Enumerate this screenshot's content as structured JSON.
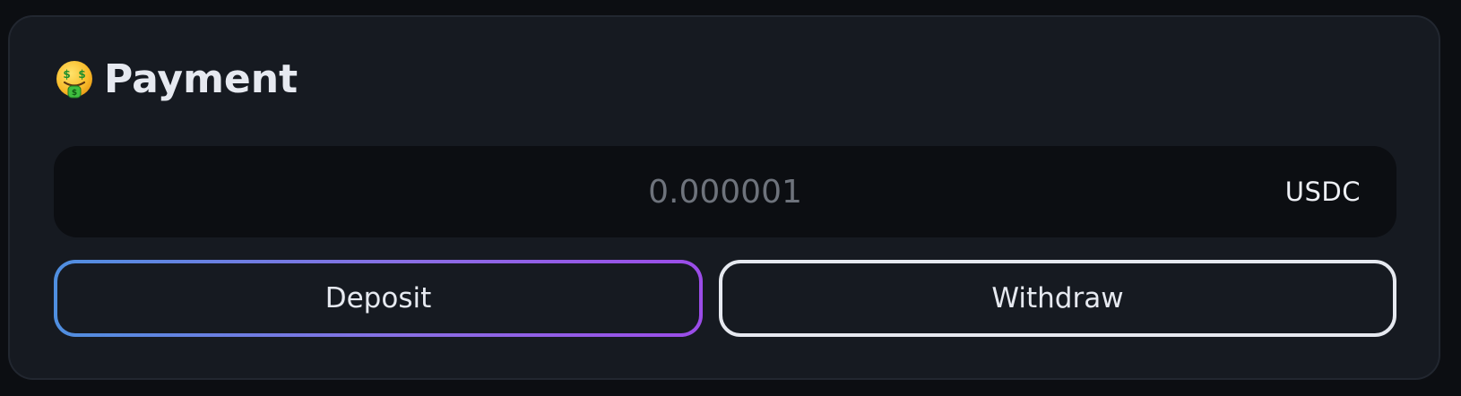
{
  "card": {
    "title": "Payment",
    "title_icon": "money-mouth-face-emoji-icon"
  },
  "amount": {
    "value": "",
    "placeholder": "0.000001",
    "currency": "USDC"
  },
  "actions": {
    "deposit_label": "Deposit",
    "withdraw_label": "Withdraw"
  },
  "colors": {
    "background": "#0c0e12",
    "card": "#161a21",
    "input_background": "#0c0e12",
    "text": "#e6e9f0",
    "placeholder": "#6e737c",
    "gradient_start": "#4f8fe0",
    "gradient_end": "#9b4ce8",
    "withdraw_border": "#e6e9f0"
  }
}
